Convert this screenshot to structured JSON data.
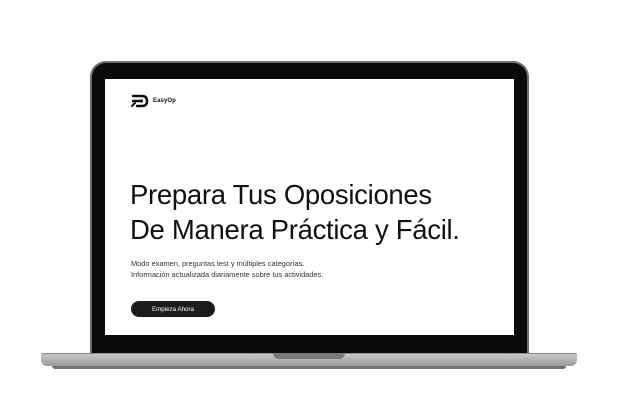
{
  "brand": {
    "name": "EasyOp",
    "logo_icon": "easyop-logo-icon"
  },
  "hero": {
    "headline_line1": "Prepara Tus Oposiciones",
    "headline_line2": "De Manera Práctica y Fácil.",
    "subtext_line1": "Modo examen, preguntas test y múltiples categorías.",
    "subtext_line2": "Información actualizada diariamente sobre tus actividades.",
    "cta_label": "Empieza Ahora"
  },
  "colors": {
    "text": "#111111",
    "button_bg": "#1c1c1c",
    "bezel": "#0b0b0b",
    "deck": "#b5b5b5"
  }
}
